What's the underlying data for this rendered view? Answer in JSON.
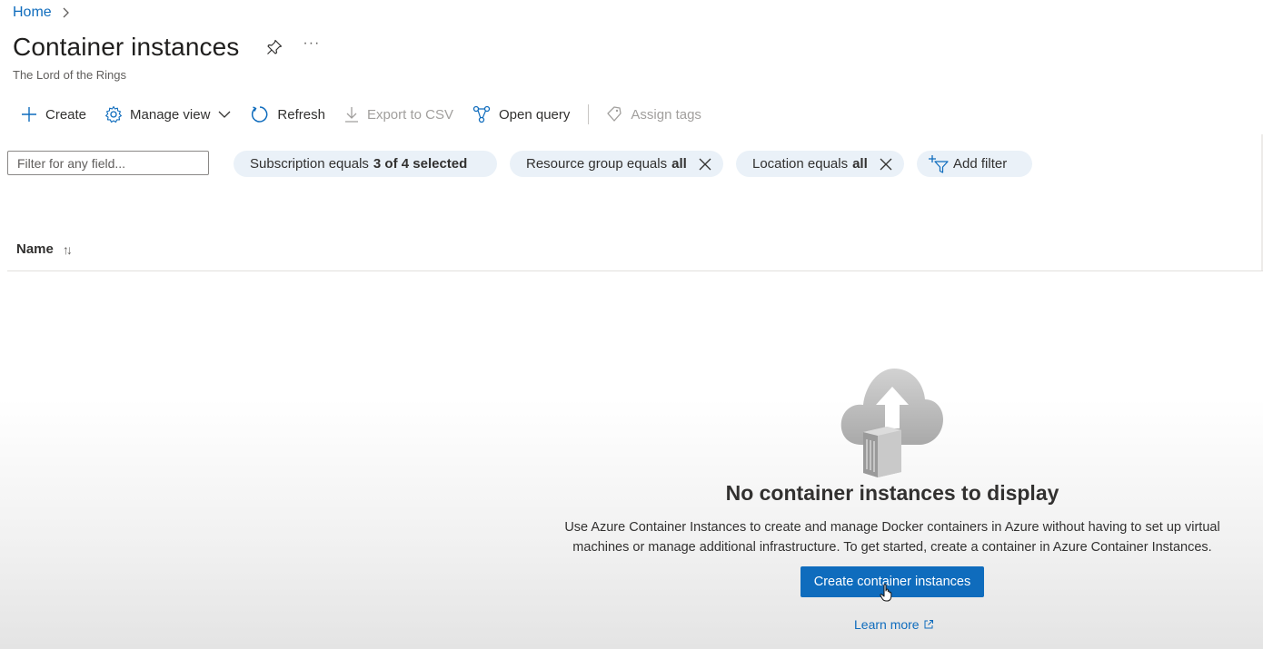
{
  "breadcrumb": {
    "home": "Home"
  },
  "header": {
    "title": "Container instances",
    "subtitle": "The Lord of the Rings",
    "more": "···"
  },
  "toolbar": {
    "create": "Create",
    "manage_view": "Manage view",
    "refresh": "Refresh",
    "export_csv": "Export to CSV",
    "open_query": "Open query",
    "assign_tags": "Assign tags"
  },
  "filters": {
    "search_placeholder": "Filter for any field...",
    "pills": [
      {
        "label": "Subscription equals",
        "value": "3 of 4 selected"
      },
      {
        "label": "Resource group equals",
        "value": "all"
      },
      {
        "label": "Location equals",
        "value": "all"
      }
    ],
    "add_filter": "Add filter"
  },
  "grid": {
    "columns": [
      {
        "label": "Name",
        "sort": "↑↓"
      }
    ]
  },
  "empty_state": {
    "title": "No container instances to display",
    "description_line1": "Use Azure Container Instances to create and manage Docker containers in Azure without having to set up virtual",
    "description_line2": "machines or manage additional infrastructure. To get started, create a container in Azure Container Instances.",
    "button": "Create container instances",
    "learn_more": "Learn more"
  },
  "colors": {
    "accent": "#0f6cbd",
    "pill_bg": "#eaf1f8",
    "text": "#323130"
  }
}
